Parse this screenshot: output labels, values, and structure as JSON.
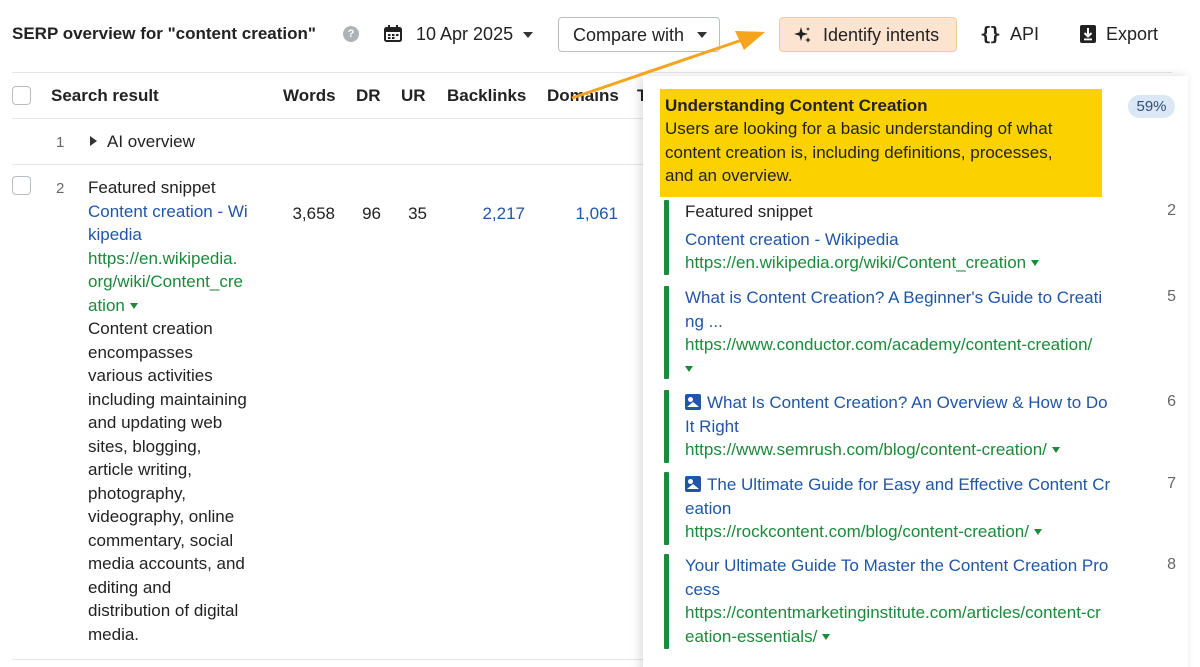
{
  "toolbar": {
    "title": "SERP overview for \"content creation\"",
    "help": "?",
    "date": "10 Apr 2025",
    "compare_label": "Compare with",
    "identify_label": "Identify intents",
    "api_icon": "{}",
    "api_label": "API",
    "export_label": "Export"
  },
  "table": {
    "headers": {
      "result": "Search result",
      "words": "Words",
      "dr": "DR",
      "ur": "UR",
      "backlinks": "Backlinks",
      "domains": "Domains",
      "truncated": "T"
    },
    "rows": [
      {
        "num": "1",
        "label": "AI overview"
      },
      {
        "num": "2",
        "type": "Featured snippet",
        "title_lines": [
          "Content creation - Wi",
          "kipedia"
        ],
        "url_lines": [
          "https://en.wikipedia.",
          "org/wiki/Content_cre",
          "ation"
        ],
        "snippet_lines": [
          "Content creation",
          "encompasses",
          "various activities",
          "including maintaining",
          "and updating web",
          "sites, blogging,",
          "article writing,",
          "photography,",
          "videography, online",
          "commentary, social",
          "media accounts, and",
          "editing and",
          "distribution of digital",
          "media."
        ],
        "words": "3,658",
        "dr": "96",
        "ur": "35",
        "backlinks": "2,217",
        "domains": "1,061"
      }
    ]
  },
  "panel": {
    "percent": "59%",
    "intent_title": "Understanding Content Creation",
    "intent_desc_lines": [
      "Users are looking for a basic understanding of what",
      "content creation is, including definitions, processes,",
      "and an overview."
    ],
    "items": [
      {
        "type": "Featured snippet",
        "title_lines": [
          "Content creation - Wikipedia"
        ],
        "url_lines": [
          "https://en.wikipedia.org/wiki/Content_creation"
        ],
        "rank": "2",
        "image": false
      },
      {
        "title_lines": [
          "What is Content Creation? A Beginner's Guide to Creati",
          "ng ..."
        ],
        "url_lines": [
          "https://www.conductor.com/academy/content-creation/",
          ""
        ],
        "rank": "5",
        "image": false
      },
      {
        "title_lines": [
          "What Is Content Creation? An Overview & How to Do",
          "It Right"
        ],
        "url_lines": [
          "https://www.semrush.com/blog/content-creation/"
        ],
        "rank": "6",
        "image": true
      },
      {
        "title_lines": [
          "The Ultimate Guide for Easy and Effective Content Cr",
          "eation"
        ],
        "url_lines": [
          "https://rockcontent.com/blog/content-creation/"
        ],
        "rank": "7",
        "image": true
      },
      {
        "title_lines": [
          "Your Ultimate Guide To Master the Content Creation Pro",
          "cess"
        ],
        "url_lines": [
          "https://contentmarketinginstitute.com/articles/content-cr",
          "eation-essentials/"
        ],
        "rank": "8",
        "image": false
      }
    ]
  },
  "colors": {
    "link": "#1f56a8",
    "url": "#1b8a3a",
    "intent_highlight": "#fbd100",
    "arrow": "#f5a41d",
    "identify_bg": "#fde4d0"
  }
}
